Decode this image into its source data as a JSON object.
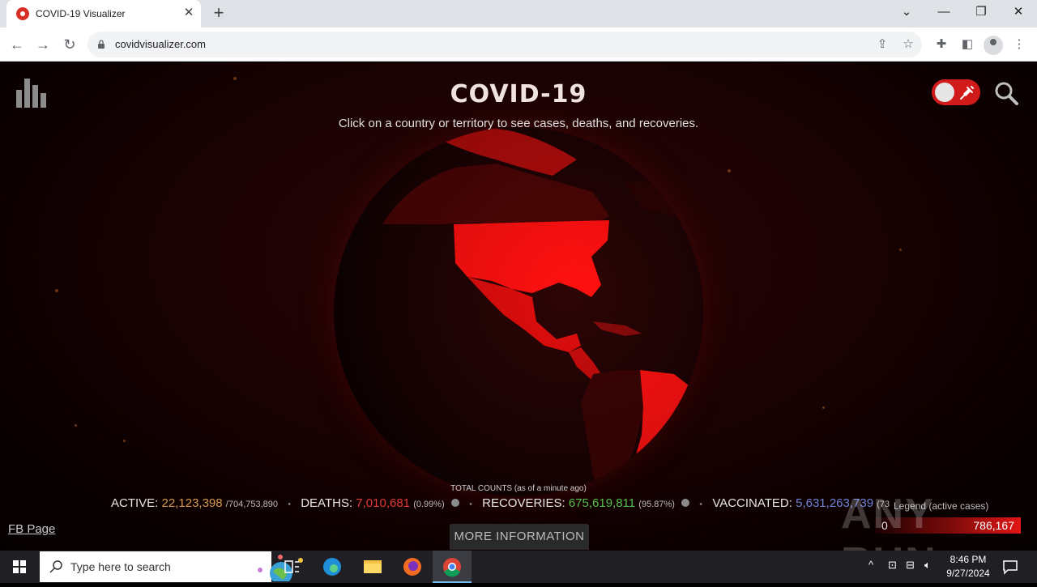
{
  "browser": {
    "tab_title": "COVID-19 Visualizer",
    "tab_close": "✕",
    "new_tab": "+",
    "url": "covidvisualizer.com",
    "controls": {
      "chevron": "⌄",
      "minimize": "—",
      "restore": "❐",
      "close": "✕"
    }
  },
  "page": {
    "title": "COVID-19",
    "subtitle": "Click on a country or territory to see cases, deaths, and recoveries.",
    "total_label": "TOTAL COUNTS (as of a minute ago)",
    "stats": {
      "active_label": "ACTIVE:",
      "active_value": "22,123,398",
      "active_total": "/704,753,890",
      "deaths_label": "DEATHS:",
      "deaths_value": "7,010,681",
      "deaths_pct": "(0.99%)",
      "recoveries_label": "RECOVERIES:",
      "recoveries_value": "675,619,811",
      "recoveries_pct": "(95.87%)",
      "vaccinated_label": "VACCINATED:",
      "vaccinated_value": "5,631,263,739",
      "vaccinated_pct": "(73"
    },
    "legend": {
      "label": "Legend (active cases)",
      "min": "0",
      "max": "786,167"
    },
    "fb_link": "FB Page",
    "more_button": "MORE INFORMATION",
    "watermark": "ANY RUN",
    "accent_color": "#d11b1b"
  },
  "taskbar": {
    "search_placeholder": "Type here to search",
    "time": "8:46 PM",
    "date": "9/27/2024"
  }
}
